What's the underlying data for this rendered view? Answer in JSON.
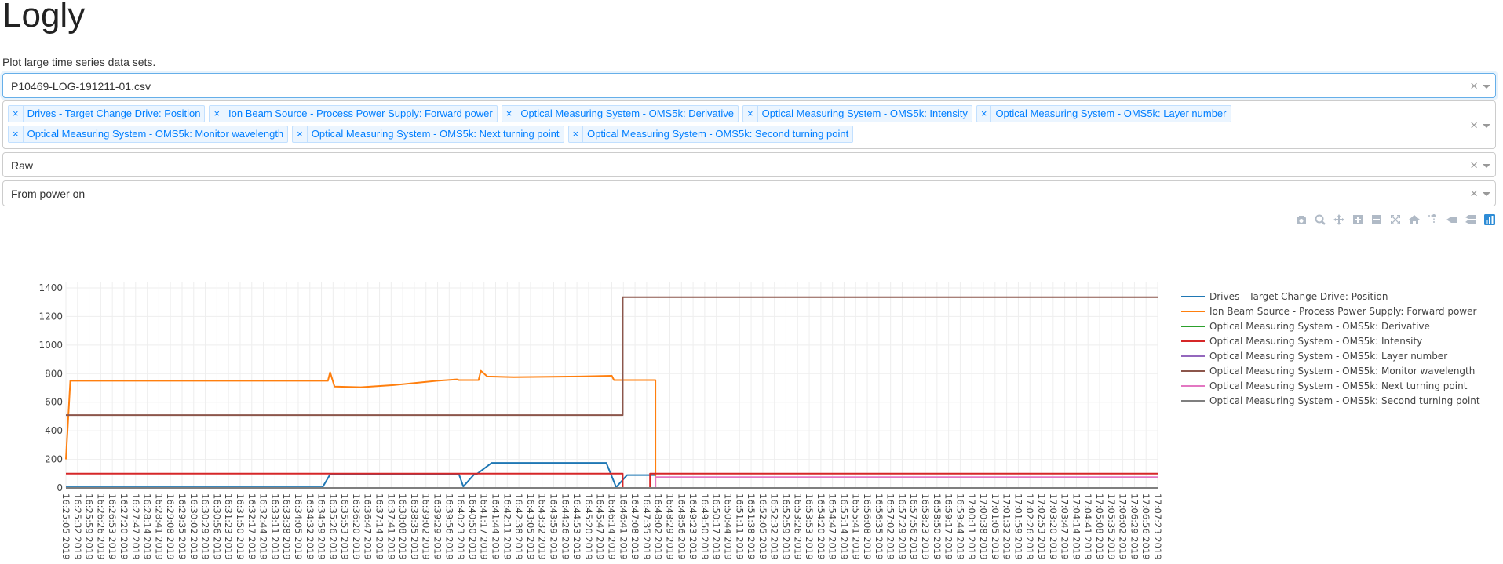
{
  "app": {
    "title": "Logly",
    "subtitle": "Plot large time series data sets."
  },
  "file_select": {
    "value": "P10469-LOG-191211-01.csv"
  },
  "signal_select": {
    "chips": [
      "Drives - Target Change Drive: Position",
      "Ion Beam Source - Process Power Supply: Forward power",
      "Optical Measuring System - OMS5k: Derivative",
      "Optical Measuring System - OMS5k: Intensity",
      "Optical Measuring System - OMS5k: Layer number",
      "Optical Measuring System - OMS5k: Monitor wavelength",
      "Optical Measuring System - OMS5k: Next turning point",
      "Optical Measuring System - OMS5k: Second turning point"
    ]
  },
  "mode_select": {
    "value": "Raw"
  },
  "time_select": {
    "value": "From power on"
  },
  "controls": {
    "clear_glyph": "×",
    "chip_remove_glyph": "×"
  },
  "modebar": {
    "icons": [
      "camera-icon",
      "zoom-icon",
      "pan-icon",
      "zoom-in-icon",
      "zoom-out-icon",
      "autoscale-icon",
      "home-icon",
      "spike-lines-icon",
      "hover-closest-icon",
      "hover-compare-icon",
      "plotly-logo-icon"
    ],
    "color": "#b0bac6",
    "active_color": "#2e8cd6"
  },
  "chart_data": {
    "type": "line",
    "x_tick_start": "16:25:05",
    "x_tick_step_seconds": 27,
    "x_tick_count": 95,
    "x_tick_suffix": " 2019",
    "yticks": [
      0,
      200,
      400,
      600,
      800,
      1000,
      1200,
      1400
    ],
    "ylim": [
      -50,
      1450
    ],
    "xlim": [
      0,
      1
    ],
    "grid": true,
    "legend_position": "right",
    "series": [
      {
        "name": "Drives - Target Change Drive: Position",
        "color": "#1f77b4",
        "points": [
          [
            0,
            5
          ],
          [
            0.235,
            5
          ],
          [
            0.242,
            95
          ],
          [
            0.36,
            95
          ],
          [
            0.364,
            10
          ],
          [
            0.374,
            95
          ],
          [
            0.376,
            95
          ],
          [
            0.376,
            95
          ],
          [
            0.39,
            175
          ],
          [
            0.495,
            175
          ],
          [
            0.504,
            5
          ],
          [
            0.514,
            90
          ],
          [
            0.54,
            90
          ],
          [
            0.54,
            90
          ]
        ]
      },
      {
        "name": "Ion Beam Source - Process Power Supply: Forward power",
        "color": "#ff7f0e",
        "points": [
          [
            0.0,
            200
          ],
          [
            0.004,
            750
          ],
          [
            0.24,
            750
          ],
          [
            0.242,
            810
          ],
          [
            0.246,
            710
          ],
          [
            0.27,
            705
          ],
          [
            0.3,
            720
          ],
          [
            0.34,
            750
          ],
          [
            0.358,
            760
          ],
          [
            0.36,
            755
          ],
          [
            0.378,
            755
          ],
          [
            0.38,
            820
          ],
          [
            0.386,
            780
          ],
          [
            0.41,
            775
          ],
          [
            0.47,
            780
          ],
          [
            0.5,
            785
          ],
          [
            0.502,
            755
          ],
          [
            0.54,
            755
          ],
          [
            0.54,
            0
          ],
          [
            1,
            0
          ]
        ]
      },
      {
        "name": "Optical Measuring System - OMS5k: Derivative",
        "color": "#2ca02c",
        "points": [
          [
            0,
            0
          ],
          [
            1,
            0
          ]
        ]
      },
      {
        "name": "Optical Measuring System - OMS5k: Intensity",
        "color": "#d62728",
        "points": [
          [
            0,
            100
          ],
          [
            0.51,
            100
          ],
          [
            0.51,
            0
          ],
          [
            0.535,
            0
          ],
          [
            0.535,
            100
          ],
          [
            1,
            100
          ]
        ]
      },
      {
        "name": "Optical Measuring System - OMS5k: Layer number",
        "color": "#9467bd",
        "points": [
          [
            0,
            0
          ],
          [
            1,
            0
          ]
        ]
      },
      {
        "name": "Optical Measuring System - OMS5k: Monitor wavelength",
        "color": "#8c564b",
        "points": [
          [
            0,
            510
          ],
          [
            0.51,
            510
          ],
          [
            0.51,
            1335
          ],
          [
            1,
            1335
          ]
        ]
      },
      {
        "name": "Optical Measuring System - OMS5k: Next turning point",
        "color": "#e377c2",
        "points": [
          [
            0,
            0
          ],
          [
            0.54,
            0
          ],
          [
            0.54,
            75
          ],
          [
            1,
            75
          ]
        ]
      },
      {
        "name": "Optical Measuring System - OMS5k: Second turning point",
        "color": "#7f7f7f",
        "points": [
          [
            0,
            0
          ],
          [
            1,
            0
          ]
        ]
      }
    ]
  }
}
